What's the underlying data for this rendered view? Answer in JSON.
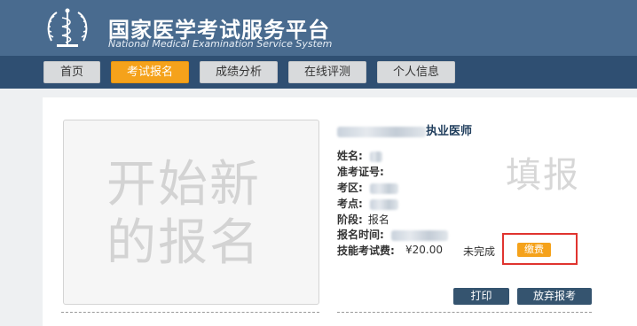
{
  "header": {
    "title": "国家医学考试服务平台",
    "subtitle": "National Medical Examination Service System",
    "logo_icon": "caduceus-emblem-icon"
  },
  "nav": {
    "items": [
      {
        "label": "首页"
      },
      {
        "label": "考试报名",
        "active": true
      },
      {
        "label": "成绩分析"
      },
      {
        "label": "在线评测"
      },
      {
        "label": "个人信息"
      }
    ]
  },
  "new_registration": {
    "line1": "开始新",
    "line2": "的报名"
  },
  "registration": {
    "exam_title_suffix": "执业医师",
    "watermark": "填报",
    "fields": {
      "name_label": "姓名:",
      "ticket_label": "准考证号:",
      "region_label": "考区:",
      "site_label": "考点:",
      "stage_label": "阶段:",
      "stage_value": "报名",
      "time_label": "报名时间:",
      "fee_label": "技能考试费:"
    },
    "fee_amount": "¥20.00",
    "fee_status": "未完成",
    "pay_button": "缴费",
    "print_button": "打印",
    "abandon_button": "放弃报考"
  },
  "colors": {
    "header_bg": "#496b8f",
    "nav_bg": "#2f4f72",
    "accent_orange": "#f5a21b",
    "button_dark": "#35546f",
    "highlight_red": "#e0342f"
  }
}
